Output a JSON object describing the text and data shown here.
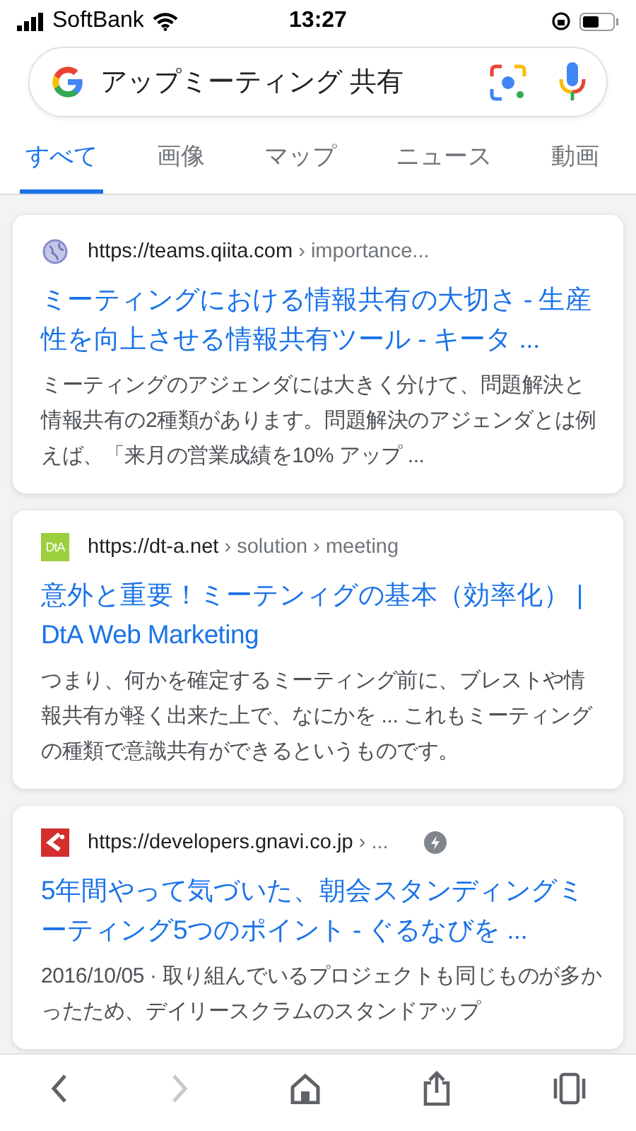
{
  "status_bar": {
    "carrier": "SoftBank",
    "time": "13:27"
  },
  "search": {
    "value": "アップミーティング 共有"
  },
  "tabs": [
    {
      "label": "すべて",
      "selected": true
    },
    {
      "label": "画像",
      "selected": false
    },
    {
      "label": "マップ",
      "selected": false
    },
    {
      "label": "ニュース",
      "selected": false
    },
    {
      "label": "動画",
      "selected": false
    }
  ],
  "results": [
    {
      "kind": "globe",
      "url": "https://teams.qiita.com",
      "path": " › importance...",
      "amp": false,
      "title": "ミーティングにおける情報共有の大切さ - 生産性を向上させる情報共有ツール - キータ ...",
      "snippet": "ミーティングのアジェンダには大きく分けて、問題解決と情報共有の2種類があります。問題解決のアジェンダとは例えば、「来月の営業成績を10% アップ ..."
    },
    {
      "kind": "text",
      "favicon_text": "DtA",
      "url": "https://dt-a.net",
      "path": " › solution › meeting",
      "amp": false,
      "title": "意外と重要！ミーテンィグの基本（効率化） | DtA Web Marketing",
      "snippet": "つまり、何かを確定するミーティング前に、ブレストや情報共有が軽く出来た上で、なにかを ... これもミーティングの種類で意識共有ができるというものです。"
    },
    {
      "kind": "red",
      "url": "https://developers.gnavi.co.jp",
      "path": " › ...",
      "amp": true,
      "title": "5年間やって気づいた、朝会スタンディングミーティング5つのポイント - ぐるなびを ...",
      "snippet": "2016/10/05 · 取り組んでいるプロジェクトも同じものが多かったため、デイリースクラムのスタンドアップ"
    }
  ],
  "toolbar": [
    {
      "kind": "back",
      "disabled": false
    },
    {
      "kind": "forward",
      "disabled": true
    },
    {
      "kind": "home",
      "disabled": false
    },
    {
      "kind": "share",
      "disabled": false
    },
    {
      "kind": "tabs",
      "disabled": false
    }
  ]
}
